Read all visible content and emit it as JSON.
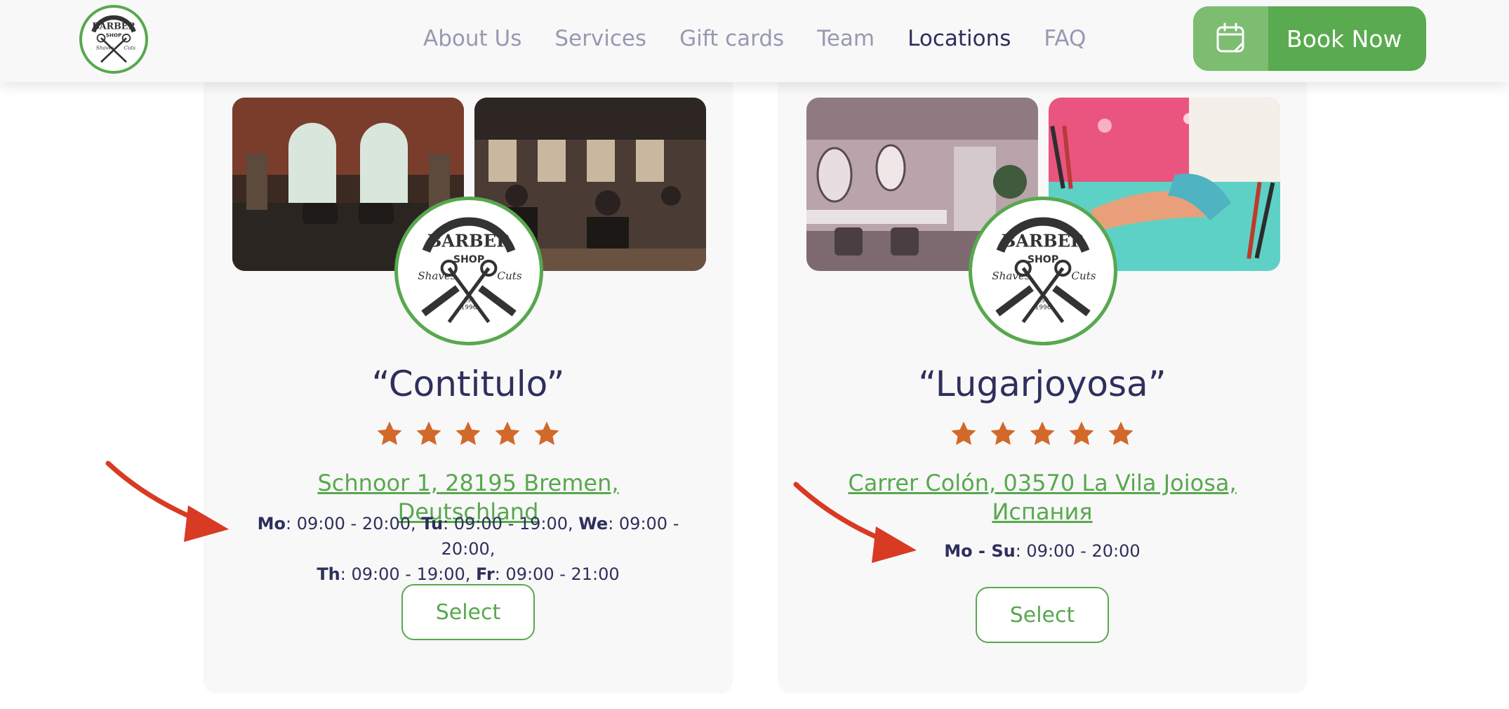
{
  "brand": {
    "logo_text": "BARBER SHOP",
    "logo_sub_left": "Shaves",
    "logo_sub_right": "Cuts",
    "logo_est": "EST 1996"
  },
  "nav": {
    "items": [
      {
        "label": "About Us",
        "active": false
      },
      {
        "label": "Services",
        "active": false
      },
      {
        "label": "Gift cards",
        "active": false
      },
      {
        "label": "Team",
        "active": false
      },
      {
        "label": "Locations",
        "active": true
      },
      {
        "label": "FAQ",
        "active": false
      }
    ]
  },
  "book": {
    "label": "Book Now",
    "icon": "calendar-icon"
  },
  "locations": [
    {
      "name": "“Contitulo”",
      "rating": 5,
      "address": "Schnoor 1, 28195 Bremen, Deutschland",
      "hours": [
        {
          "day": "Mo",
          "time": ": 09:00 - 20:00, "
        },
        {
          "day": "Tu",
          "time": ": 09:00 - 19:00, "
        },
        {
          "day": "We",
          "time": ": 09:00 - 20:00,"
        },
        {
          "day": "Th",
          "time": ": 09:00 - 19:00, "
        },
        {
          "day": "Fr",
          "time": ": 09:00 - 21:00"
        }
      ],
      "select_label": "Select"
    },
    {
      "name": "“Lugarjoyosa”",
      "rating": 5,
      "address": "Carrer Colón, 03570 La Vila Joiosa, Испания",
      "hours": [
        {
          "day": "Mo - Su",
          "time": ": 09:00 - 20:00"
        }
      ],
      "select_label": "Select"
    }
  ],
  "colors": {
    "accent": "#58a84e",
    "text_dark": "#2e2f5c",
    "nav_muted": "#9899b3",
    "star": "#d2692a",
    "annotation_arrow": "#d83a24"
  }
}
